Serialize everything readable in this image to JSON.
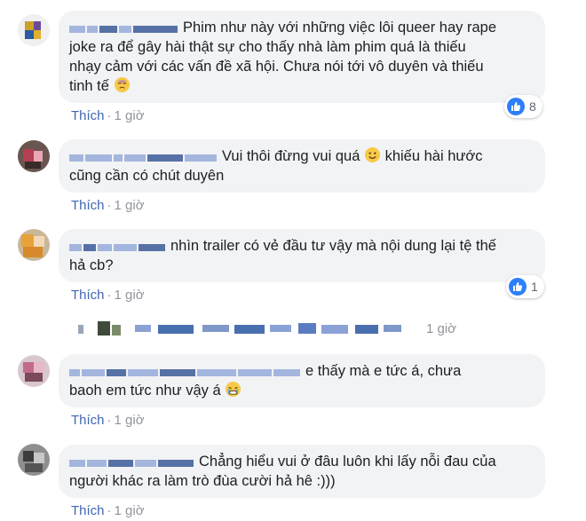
{
  "comments": [
    {
      "text_lines": [
        "Phim như này với những việc lôi queer hay rape",
        "joke ra để gây hài thật sự cho thấy nhà làm phim quá là thiếu",
        "nhạy cảm với các vấn đề xã hội. Chưa nói tới vô duyên và thiếu",
        "tinh tế"
      ],
      "emoji": "pensive-face",
      "like_label": "Thích",
      "time": "1 giờ",
      "reactions": "8"
    },
    {
      "text_lines": [
        "Vui thôi đừng vui quá",
        "khiếu hài hước",
        "cũng cần có chút duyên"
      ],
      "emoji": "smiling-face",
      "like_label": "Thích",
      "time": "1 giờ"
    },
    {
      "text_lines": [
        "nhìn trailer có vẻ đầu tư vậy mà nội dung lại tệ thế",
        "hả cb?"
      ],
      "like_label": "Thích",
      "time": "1 giờ",
      "reactions": "1"
    },
    {
      "text_lines": [
        "e thấy mà e tức á, chưa",
        "baoh em tức như vậy á"
      ],
      "emoji": "crying-face",
      "like_label": "Thích",
      "time": "1 giờ"
    },
    {
      "text_lines": [
        "Chẳng hiểu vui ở đâu luôn khi lấy nỗi đau của",
        "người khác ra làm trò đùa cười hả hê :)))"
      ],
      "like_label": "Thích",
      "time": "1 giờ"
    }
  ],
  "reply_preview": {
    "time": "1 giờ"
  },
  "separator": "·",
  "colors": {
    "bubble": "#f2f3f5",
    "link": "#4267b2",
    "meta": "#90949c",
    "like_badge": "#2d7ff9"
  }
}
